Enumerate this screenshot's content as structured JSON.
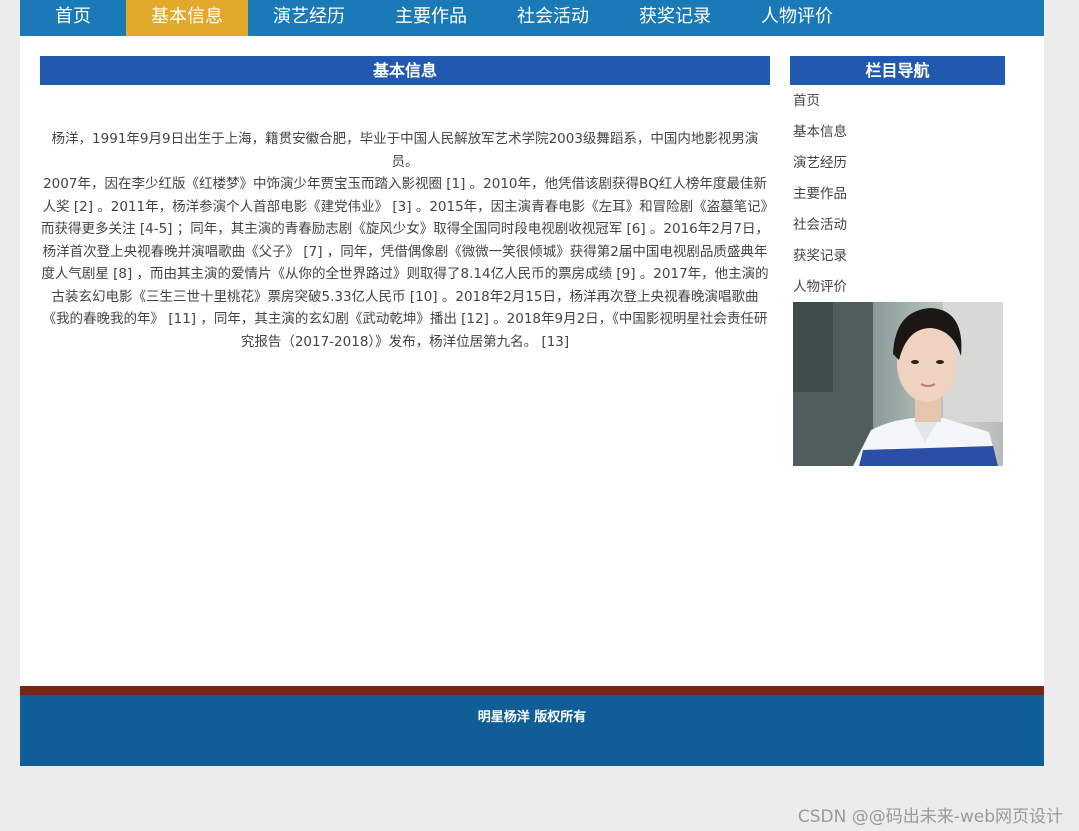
{
  "nav": {
    "items": [
      {
        "label": "首页",
        "active": false
      },
      {
        "label": "基本信息",
        "active": true
      },
      {
        "label": "演艺经历",
        "active": false
      },
      {
        "label": "主要作品",
        "active": false
      },
      {
        "label": "社会活动",
        "active": false
      },
      {
        "label": "获奖记录",
        "active": false
      },
      {
        "label": "人物评价",
        "active": false
      }
    ]
  },
  "main": {
    "title": "基本信息",
    "paragraphs": [
      "杨洋，1991年9月9日出生于上海，籍贯安徽合肥，毕业于中国人民解放军艺术学院2003级舞蹈系，中国内地影视男演员。",
      "2007年，因在李少红版《红楼梦》中饰演少年贾宝玉而踏入影视圈 [1] 。2010年，他凭借该剧获得BQ红人榜年度最佳新人奖 [2] 。2011年，杨洋参演个人首部电影《建党伟业》 [3] 。2015年，因主演青春电影《左耳》和冒险剧《盗墓笔记》而获得更多关注 [4-5] ；同年，其主演的青春励志剧《旋风少女》取得全国同时段电视剧收视冠军 [6] 。2016年2月7日，杨洋首次登上央视春晚并演唱歌曲《父子》 [7] ，同年，凭借偶像剧《微微一笑很倾城》获得第2届中国电视剧品质盛典年度人气剧星 [8] ，而由其主演的爱情片《从你的全世界路过》则取得了8.14亿人民币的票房成绩 [9] 。2017年，他主演的古装玄幻电影《三生三世十里桃花》票房突破5.33亿人民币 [10] 。2018年2月15日，杨洋再次登上央视春晚演唱歌曲《我的春晚我的年》 [11] ，同年，其主演的玄幻剧《武动乾坤》播出 [12] 。2018年9月2日，《中国影视明星社会责任研究报告（2017-2018）》发布，杨洋位居第九名。 [13]"
    ]
  },
  "sidebar": {
    "title": "栏目导航",
    "items": [
      "首页",
      "基本信息",
      "演艺经历",
      "主要作品",
      "社会活动",
      "获奖记录",
      "人物评价"
    ]
  },
  "footer": {
    "text": "明星杨洋 版权所有"
  },
  "watermark": "CSDN @@码出未来-web网页设计",
  "colors": {
    "nav_bg": "#1a7ab8",
    "nav_active": "#e3a92a",
    "header_bg": "#2059ad",
    "footer_bg": "#0f5e97",
    "footer_line": "#7a2416"
  }
}
